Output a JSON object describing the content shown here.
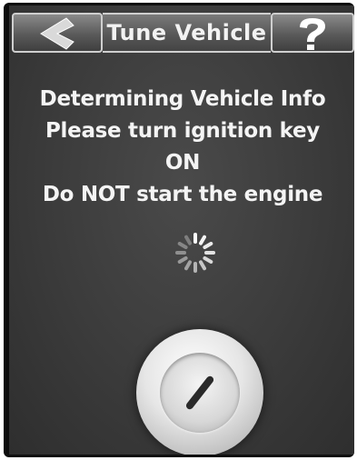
{
  "header": {
    "title": "Tune Vehicle",
    "back_icon": "chevron-left-icon",
    "help_icon": "question-mark-icon"
  },
  "message": {
    "line1": "Determining Vehicle Info",
    "line2": "Please turn ignition key",
    "line3": "ON",
    "line4": "Do NOT start the engine"
  },
  "status": {
    "spinner_icon": "loading-spinner-icon"
  },
  "ignition": {
    "icon": "ignition-key-icon"
  },
  "colors": {
    "background": "#3b3b3b",
    "text": "#f4f4f4",
    "header_border": "#cfcfcf"
  }
}
